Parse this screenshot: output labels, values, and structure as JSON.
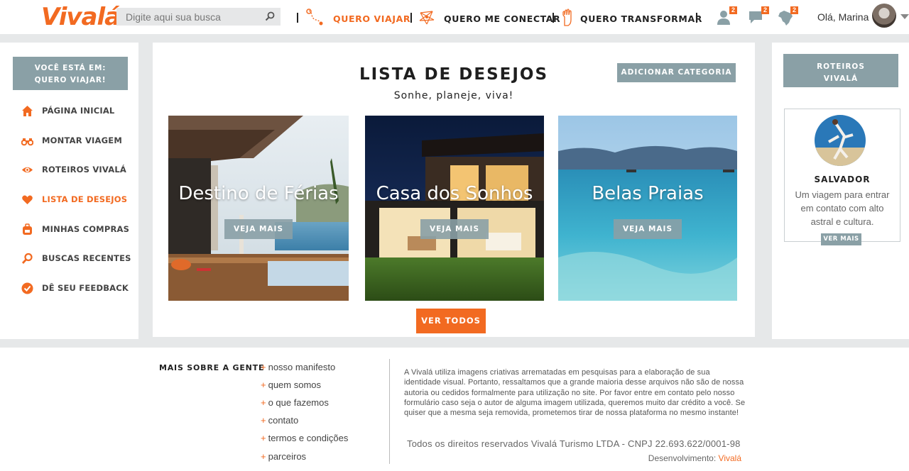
{
  "header": {
    "logo": "Vivalá",
    "search_placeholder": "Digite aqui sua busca",
    "nav": [
      {
        "label": "QUERO VIAJAR",
        "icon": "route-pin-icon"
      },
      {
        "label": "QUERO ME CONECTAR",
        "icon": "network-icon"
      },
      {
        "label": "QUERO TRANSFORMAR",
        "icon": "hand-icon"
      }
    ],
    "badges": {
      "user": "2",
      "chat": "2",
      "map": "2"
    },
    "greeting": "Olá, Marina"
  },
  "sidebar": {
    "location_line1": "VOCÊ ESTÁ EM:",
    "location_line2": "QUERO VIAJAR!",
    "items": [
      {
        "label": "PÁGINA INICIAL",
        "icon": "home-icon"
      },
      {
        "label": "MONTAR VIAGEM",
        "icon": "binoculars-icon"
      },
      {
        "label": "ROTEIROS VIVALÁ",
        "icon": "eye-icon"
      },
      {
        "label": "LISTA DE DESEJOS",
        "icon": "heart-icon"
      },
      {
        "label": "MINHAS COMPRAS",
        "icon": "backpack-icon"
      },
      {
        "label": "BUSCAS RECENTES",
        "icon": "search-icon"
      },
      {
        "label": "DÊ SEU FEEDBACK",
        "icon": "check-circle-icon"
      }
    ]
  },
  "main": {
    "title": "LISTA DE DESEJOS",
    "subtitle": "Sonhe, planeje, viva!",
    "add_category": "ADICIONAR  CATEGORIA",
    "cards": [
      {
        "title": "Destino de Férias",
        "button": "VEJA MAIS"
      },
      {
        "title": "Casa dos Sonhos",
        "button": "VEJA MAIS"
      },
      {
        "title": "Belas Praias",
        "button": "VEJA MAIS"
      }
    ],
    "see_all": "VER TODOS"
  },
  "right": {
    "roteiros_line1": "ROTEIROS",
    "roteiros_line2": "VIVALÁ",
    "city": "SALVADOR",
    "city_desc": "Um viagem para entrar em contato com alto astral e cultura.",
    "see_more": "VER MAIS"
  },
  "footer": {
    "heading": "MAIS SOBRE A GENTE",
    "links": [
      "nosso manifesto",
      "quem somos",
      "o que fazemos",
      "contato",
      "termos e condições",
      "parceiros"
    ],
    "disclaimer": "A Vivalá utiliza imagens criativas arrematadas em pesquisas para a elaboração de sua identidade visual. Portanto, ressaltamos que a grande maioria desse arquivos não são de nossa autoria ou cedidos formalmente para utilização no site. Por favor entre em contato pelo nosso formulário caso seja o autor de alguma imagem utilizada, queremos muito dar crédito a você. Se quiser que a mesma seja removida, prometemos tirar de nossa plataforma no mesmo instante!",
    "rights": "Todos os direitos reservados Vivalá Turismo LTDA   -  CNPJ 22.693.622/0001-98",
    "dev_label": "Desenvolvimento:",
    "dev_name": "Vivalá"
  },
  "colors": {
    "accent": "#f26a21",
    "slate": "#8aa0a6",
    "bg": "#e6e8e9"
  }
}
